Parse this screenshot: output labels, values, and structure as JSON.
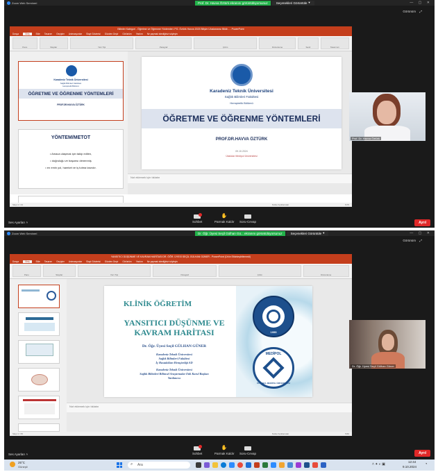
{
  "shot1": {
    "app_title": "Zoom Web Semineri",
    "banner_text": "Prof. Dr. Havva Öztürk ekranını görüntülüyorsunuz",
    "view_options": "Seçenekleri Görüntüle",
    "gallery_label": "Görünüm",
    "ppt_title": "Bilimler Kategori - Öğretme ve Öğrenme Yöntemleri. PG. Öztürk Havva 2023 Bilişim Uluslararası Bildir... - PowerPoint",
    "tabs": [
      "Dosya",
      "Giriş",
      "Ekle",
      "Tasarım",
      "Geçişler",
      "Animasyonlar",
      "Slayt Gösterisi",
      "Gözden Geçir",
      "Görünüm",
      "Yardım",
      "Ne yapmak istediğinizi söyleyin"
    ],
    "ribbon_groups": [
      "Pano",
      "Slaytlar",
      "Yazı Tipi",
      "Paragraf",
      "Çizim",
      "Düzenleme",
      "Sesli",
      "Tasarımcı"
    ],
    "thumb1": {
      "university": "Karadeniz Teknik Üniversitesi",
      "faculty": "Sağlık Bilimleri Fakültesi",
      "dept": "Hemşirelik Bölümü",
      "title": "ÖĞRETME VE ÖĞRENME YÖNTEMLERİ",
      "author": "PROF.DR.HAVVA ÖZTÜRK"
    },
    "thumb2": {
      "title": "YÖNTEM/METOT",
      "bullets": [
        "Amaca ulaşmak için takip edilen,",
        "doğruluğu ve başarısı denenmiş",
        "en emin yol, hareket ve iş tutma tarzıdır."
      ]
    },
    "slide": {
      "university": "Karadeniz Teknik Üniversitesi",
      "faculty": "Sağlık Bilimleri Fakültesi",
      "dept": "Hemşirelik Bölümü",
      "title": "ÖĞRETME VE ÖĞRENME YÖNTEMLERİ",
      "author": "PROF.DR.HAVVA ÖZTÜRK",
      "date": "09.10.2024",
      "dept_link": "Üsküdar Medipol Üniversitesi"
    },
    "notes": "Not eklemek için tıklatın",
    "status_left": "Slayt 1 / 44",
    "status_right": "Notlar   Açıklamalar",
    "zoom_pct": "%75",
    "participant": "Prof. Dr. Havva Öztürk",
    "audio": "Ses Ayarları",
    "controls": [
      "Sohbet",
      "Parmak Kaldır",
      "Soru-Cevap"
    ],
    "leave": "Ayrıl"
  },
  "shot2": {
    "app_title": "Zoom Web Semineri",
    "banner_text": "Dr. Öğr. Üyesi Seçil Gülhan Gü... ekranını görüntülüyorsunuz",
    "view_options": "Seçenekleri Görüntüle",
    "gallery_label": "Görünüm",
    "ppt_title": "YANSITICI DÜŞÜNME VE KAVRAM HARİTASI DR. ÖĞR. ÜYESİ SEÇİL GÜLHAN GÜNER - PowerPoint (Ürün Etkinleştirilemedi)",
    "tabs": [
      "Dosya",
      "Giriş",
      "Ekle",
      "Tasarım",
      "Geçişler",
      "Animasyonlar",
      "Slayt Gösterisi",
      "Gözden Geçir",
      "Görünüm",
      "Yardım",
      "Ne yapmak istediğinizi söyleyin"
    ],
    "ribbon_groups": [
      "Pano",
      "Slaytlar",
      "Yazı Tipi",
      "Paragraf",
      "Çizim",
      "Düzenleme"
    ],
    "slide": {
      "heading": "KLİNİK ÖĞRETİM",
      "title_line1": "YANSITICI DÜŞÜNME VE",
      "title_line2": "KAVRAM HARİTASI",
      "author": "Dr. Öğr. Üyesi Seçil GÜLHAN GÜNER",
      "aff1": "Karadeniz Teknik Üniversitesi",
      "aff2": "Sağlık Bilimleri Fakültesi",
      "aff3": "İç Hastalıkları Hemşireliği AD",
      "aff4": "Karadeniz Teknik Üniversitesi",
      "aff5": "Sağlık Bilimleri Bilimsel Araştırmalar Etik Kurul Başkan",
      "aff6": "Yardımcısı",
      "seal1_text": "KARADENİZ TEKNİK ÜNİVERSİTESİ",
      "seal1_year": "1955",
      "seal2_text": "MEDİPOL",
      "seal2_sub": "İSTANBUL MEDİPOL ÜNİVERSİTESİ"
    },
    "thumb_labels": [
      "1",
      "2",
      "3",
      "4",
      "5"
    ],
    "notes": "Not eklemek için tıklatın",
    "status_left": "Slayt 1 / 65",
    "status_right": "Notlar   Açıklamalar",
    "zoom_pct": "%60",
    "participant": "Dr. Öğr. Üyesi Seçil Gülhan Güner",
    "audio": "Ses Ayarları",
    "controls": [
      "Sohbet",
      "Parmak Kaldır",
      "Soru-Cevap"
    ],
    "leave": "Ayrıl"
  },
  "taskbar": {
    "weather_temp": "25°C",
    "weather_desc": "Güneşli",
    "search_placeholder": "Ara",
    "time": "12:44",
    "date": "9.10.2024"
  }
}
